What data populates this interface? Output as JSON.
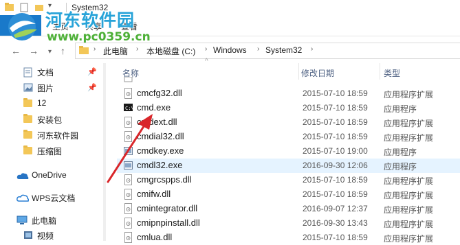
{
  "window": {
    "title": "System32"
  },
  "watermark": {
    "text": "河东软件园",
    "url": "www.pc0359.cn"
  },
  "ribbon": {
    "tabs": [
      "主页",
      "共享",
      "查看"
    ]
  },
  "address": {
    "segments": [
      "此电脑",
      "本地磁盘 (C:)",
      "Windows",
      "System32"
    ]
  },
  "sidebar": {
    "items": [
      {
        "label": "文档",
        "icon": "document-icon",
        "pinned": true
      },
      {
        "label": "图片",
        "icon": "picture-icon",
        "pinned": true
      },
      {
        "label": "12",
        "icon": "folder-icon",
        "pinned": false
      },
      {
        "label": "安装包",
        "icon": "folder-icon",
        "pinned": false
      },
      {
        "label": "河东软件园",
        "icon": "folder-icon",
        "pinned": false
      },
      {
        "label": "压缩图",
        "icon": "folder-icon",
        "pinned": false
      },
      {
        "label": "OneDrive",
        "icon": "cloud-icon",
        "pinned": false
      },
      {
        "label": "WPS云文档",
        "icon": "wps-cloud-icon",
        "pinned": false
      },
      {
        "label": "此电脑",
        "icon": "computer-icon",
        "pinned": false
      },
      {
        "label": "视频",
        "icon": "video-icon",
        "pinned": false
      }
    ]
  },
  "columns": {
    "name": "名称",
    "date": "修改日期",
    "type": "类型"
  },
  "files": [
    {
      "name": "cmcfg32.dll",
      "date": "2015-07-10 18:59",
      "type": "应用程序扩展",
      "icon": "dll-icon"
    },
    {
      "name": "cmd.exe",
      "date": "2015-07-10 18:59",
      "type": "应用程序",
      "icon": "cmd-icon"
    },
    {
      "name": "cmdext.dll",
      "date": "2015-07-10 18:59",
      "type": "应用程序扩展",
      "icon": "dll-icon"
    },
    {
      "name": "cmdial32.dll",
      "date": "2015-07-10 18:59",
      "type": "应用程序扩展",
      "icon": "dll-icon"
    },
    {
      "name": "cmdkey.exe",
      "date": "2015-07-10 19:00",
      "type": "应用程序",
      "icon": "exe-icon"
    },
    {
      "name": "cmdl32.exe",
      "date": "2016-09-30 12:06",
      "type": "应用程序",
      "icon": "exe-icon"
    },
    {
      "name": "cmgrcspps.dll",
      "date": "2015-07-10 18:59",
      "type": "应用程序扩展",
      "icon": "dll-icon"
    },
    {
      "name": "cmifw.dll",
      "date": "2015-07-10 18:59",
      "type": "应用程序扩展",
      "icon": "dll-icon"
    },
    {
      "name": "cmintegrator.dll",
      "date": "2016-09-07 12:37",
      "type": "应用程序扩展",
      "icon": "dll-icon"
    },
    {
      "name": "cmipnpinstall.dll",
      "date": "2016-09-30 13:43",
      "type": "应用程序扩展",
      "icon": "dll-icon"
    },
    {
      "name": "cmlua.dll",
      "date": "2015-07-10 18:59",
      "type": "应用程序扩展",
      "icon": "dll-icon"
    }
  ],
  "colors": {
    "accent": "#1979ca",
    "selection": "#e5f3ff",
    "arrow": "#d9262a",
    "watermark": "#27a3d8",
    "watermark_url": "#4db037"
  }
}
